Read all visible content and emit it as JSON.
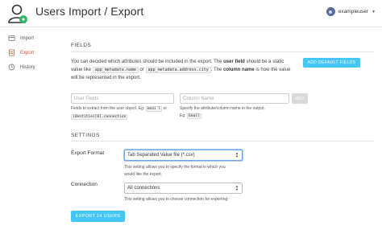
{
  "header": {
    "title": "Users Import / Export",
    "username": "exampleuser"
  },
  "sidebar": {
    "items": [
      {
        "label": "Import",
        "icon": "import-icon",
        "active": false
      },
      {
        "label": "Export",
        "icon": "export-icon",
        "active": true
      },
      {
        "label": "History",
        "icon": "history-icon",
        "active": false
      }
    ]
  },
  "fields": {
    "title": "FIELDS",
    "intro_1": "You can decided which attributes should be included in the export. The ",
    "intro_bold_1": "user field",
    "intro_2": " should be a static value like ",
    "code_1": "app_metadata.name",
    "intro_3": " or ",
    "code_2": "app_metadata.address.city",
    "intro_4": ". The ",
    "intro_bold_2": "column name",
    "intro_5": " is how the value will be represented in the export.",
    "add_default_label": "ADD DEFAULT FIELDS",
    "user_fields_placeholder": "User Fields",
    "column_name_placeholder": "Column Name",
    "add_label": "ADD",
    "user_help_1": "Fields to extract from the user object. Eg: ",
    "user_help_code_1": "emai l",
    "user_help_2": " or ",
    "user_help_code_2": "identities[0].connection",
    "column_help_1": "Specify the attribute/column name in the output.",
    "column_help_2": "Eg: ",
    "column_help_code": "Email"
  },
  "settings": {
    "title": "SETTINGS",
    "format_label": "Export Format",
    "format_value": "Tab Separated Value file (*.csv)",
    "format_help": "This setting allows you to specify the format in which you would like the export.",
    "connection_label": "Connection",
    "connection_value": "All connections",
    "connection_help": "This setting allows you to choose connection for exporting.",
    "export_label": "EXPORT 14 USERS"
  },
  "colors": {
    "accent": "#44c7f4",
    "active_nav": "#e0533a"
  }
}
